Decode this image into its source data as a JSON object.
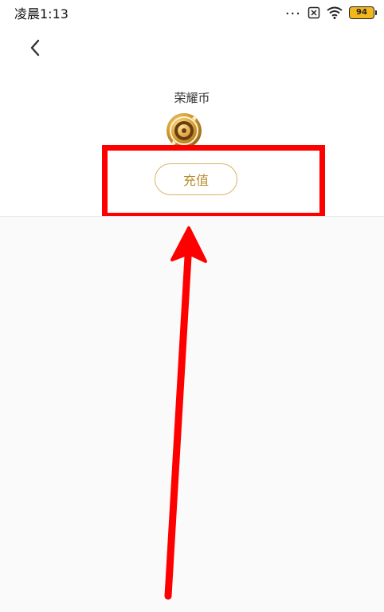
{
  "status_bar": {
    "time": "凌晨1:13",
    "signal_dots": "...",
    "battery_level": "94"
  },
  "header": {
    "back_icon": "chevron-left-icon"
  },
  "wallet": {
    "title": "荣耀币",
    "coin_icon": "coin-icon",
    "recharge_label": "充值"
  },
  "colors": {
    "accent_gold": "#d9b46a",
    "recharge_text": "#b98d2e",
    "annotation_red": "#ff0000"
  }
}
